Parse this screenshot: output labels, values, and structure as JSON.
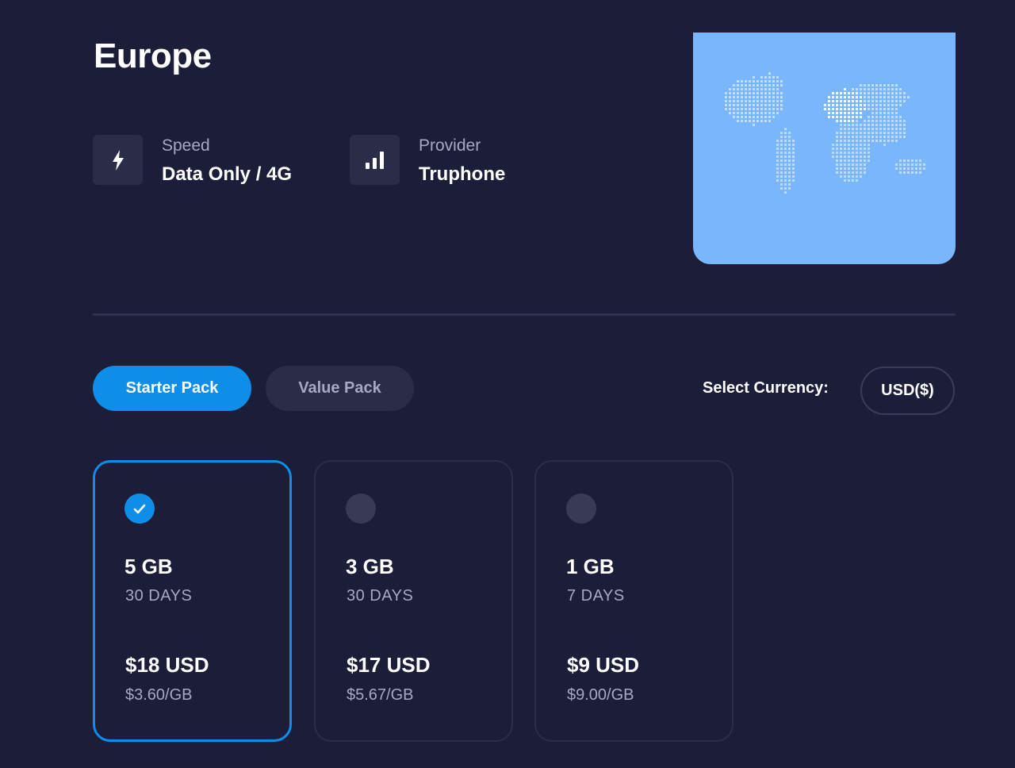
{
  "region": {
    "title": "Europe"
  },
  "info": {
    "speed": {
      "label": "Speed",
      "value": "Data Only / 4G",
      "icon": "lightning-icon"
    },
    "provider": {
      "label": "Provider",
      "value": "Truphone",
      "icon": "signal-bars-icon"
    }
  },
  "map": {
    "icon": "world-map-icon",
    "color": "#79b6fc"
  },
  "tabs": [
    {
      "label": "Starter Pack",
      "active": true
    },
    {
      "label": "Value Pack",
      "active": false
    }
  ],
  "currency": {
    "label": "Select Currency:",
    "value": "USD($)"
  },
  "plans": [
    {
      "size": "5 GB",
      "duration": "30 DAYS",
      "price": "$18 USD",
      "rate": "$3.60/GB",
      "selected": true
    },
    {
      "size": "3 GB",
      "duration": "30 DAYS",
      "price": "$17 USD",
      "rate": "$5.67/GB",
      "selected": false
    },
    {
      "size": "1 GB",
      "duration": "7 DAYS",
      "price": "$9 USD",
      "rate": "$9.00/GB",
      "selected": false
    }
  ],
  "colors": {
    "background": "#1c1d38",
    "accent": "#0e8ee8",
    "muted_text": "#a7a9c0",
    "tile": "#2a2c48"
  }
}
